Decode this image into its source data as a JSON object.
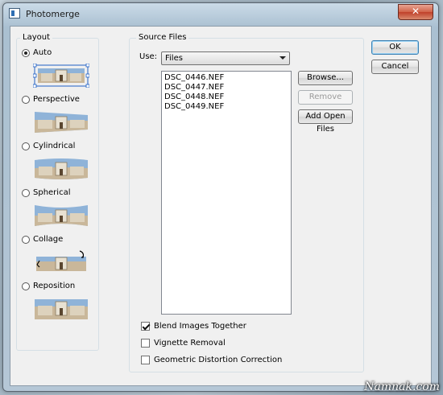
{
  "window": {
    "title": "Photomerge",
    "close_glyph": "✕"
  },
  "layout": {
    "legend": "Layout",
    "options": [
      {
        "label": "Auto",
        "checked": true,
        "icon": "auto-thumbnail-icon"
      },
      {
        "label": "Perspective",
        "checked": false,
        "icon": "perspective-thumbnail-icon"
      },
      {
        "label": "Cylindrical",
        "checked": false,
        "icon": "cylindrical-thumbnail-icon"
      },
      {
        "label": "Spherical",
        "checked": false,
        "icon": "spherical-thumbnail-icon"
      },
      {
        "label": "Collage",
        "checked": false,
        "icon": "collage-thumbnail-icon"
      },
      {
        "label": "Reposition",
        "checked": false,
        "icon": "reposition-thumbnail-icon"
      }
    ]
  },
  "source": {
    "legend": "Source Files",
    "use_label": "Use:",
    "use_value": "Files",
    "files": [
      "DSC_0446.NEF",
      "DSC_0447.NEF",
      "DSC_0448.NEF",
      "DSC_0449.NEF"
    ],
    "browse_label": "Browse...",
    "remove_label": "Remove",
    "add_open_label": "Add Open Files"
  },
  "options": {
    "blend_label": "Blend Images Together",
    "blend_checked": true,
    "vignette_label": "Vignette Removal",
    "vignette_checked": false,
    "geometric_label": "Geometric Distortion Correction",
    "geometric_checked": false
  },
  "actions": {
    "ok_label": "OK",
    "cancel_label": "Cancel"
  },
  "watermark": "Namnak.com"
}
